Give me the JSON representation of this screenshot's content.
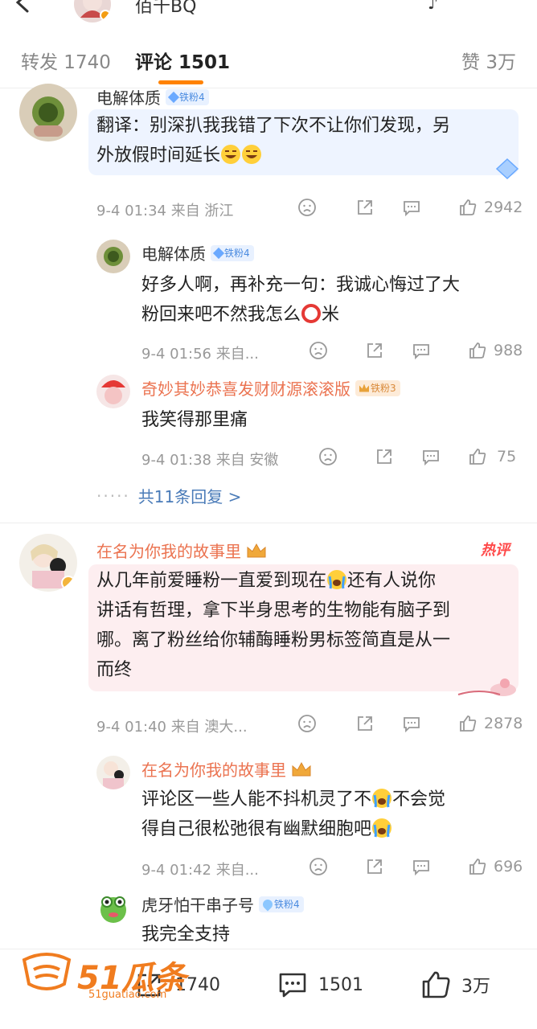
{
  "header": {
    "title": "佰千BQ"
  },
  "tabs": {
    "repost": "转发 1740",
    "comments": "评论 1501",
    "likes": "赞 3万"
  },
  "comments": [
    {
      "user": "电解体质",
      "fan_badge": "铁粉4",
      "text_1": "翻译：别深扒我我错了下次不让你们发现，另",
      "text_2": "外放假时间延长",
      "meta": "9-4 01:34 来自 浙江",
      "likes": "2942",
      "replies": [
        {
          "user": "电解体质",
          "fan_badge": "铁粉4",
          "text_1": "好多人啊，再补充一句：我诚心悔过了大",
          "text_2a": "粉回来吧不然我怎么",
          "text_2b": "米",
          "meta": "9-4 01:56 来自...",
          "likes": "988"
        },
        {
          "user": "奇妙其妙恭喜发财财源滚滚版",
          "fan_badge": "铁粉3",
          "text_1": "我笑得那里痛",
          "meta": "9-4 01:38 来自 安徽",
          "likes": "75"
        }
      ],
      "more_replies": "共11条回复 >"
    },
    {
      "user": "在名为你我的故事里",
      "hot_tag": "热评",
      "text_1a": "从几年前爱睡粉一直爱到现在",
      "text_1b": "还有人说你",
      "text_2": "讲话有哲理，拿下半身思考的生物能有脑子到",
      "text_3": "哪。离了粉丝给你辅酶睡粉男标签简直是从一",
      "text_4": "而终",
      "meta": "9-4 01:40 来自 澳大...",
      "likes": "2878",
      "replies": [
        {
          "user": "在名为你我的故事里",
          "text_1a": "评论区一些人能不抖机灵了不",
          "text_1b": "不会觉",
          "text_2": "得自己很松弛很有幽默细胞吧",
          "meta": "9-4 01:42 来自...",
          "likes": "696"
        },
        {
          "user": "虎牙怕干串子号",
          "fan_badge": "铁粉4",
          "text_1": "我完全支持"
        }
      ]
    }
  ],
  "bottom_bar": {
    "repost": "1740",
    "comments": "1501",
    "likes": "3万"
  },
  "watermark": {
    "brand": "51瓜条",
    "site": "51guatiao.com"
  },
  "colors": {
    "accent": "#ff8200",
    "vip_name": "#eb7350",
    "link": "#4a7bb8",
    "hot": "#ff4a4a"
  }
}
